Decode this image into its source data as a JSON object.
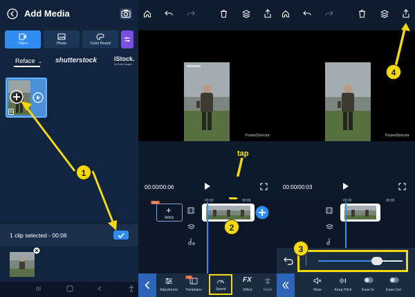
{
  "panel1": {
    "title": "Add Media",
    "tabs": [
      {
        "label": "Video",
        "active": true
      },
      {
        "label": "Photo",
        "active": false
      },
      {
        "label": "Color Board",
        "active": false
      }
    ],
    "source_filter": "Reface",
    "providers": [
      "shutterstock",
      "iStock."
    ],
    "istock_sub": "by Getty Images",
    "selection_status": "1 clip selected - 00:06",
    "callout": "1"
  },
  "panel2": {
    "watermark": "PowerDirector",
    "time": "00:00/00:06",
    "intro_badge": "New",
    "intro_label": "Intro",
    "ruler": [
      "00:00",
      "00:05"
    ],
    "tap_label": "tap",
    "callout": "2",
    "tools": [
      {
        "label": "Adjustment",
        "icon": "sliders-icon"
      },
      {
        "label": "Templates",
        "icon": "templates-icon",
        "badge": "Try"
      },
      {
        "label": "Speed",
        "icon": "speedometer-icon"
      },
      {
        "label": "Effect",
        "icon": "fx-icon"
      },
      {
        "label": "Stabil",
        "icon": "stabilizer-icon"
      }
    ],
    "fx_text": "FX"
  },
  "panel3": {
    "watermark": "PowerDirector",
    "time": "00:00/00:03",
    "ruler": [
      "00:00",
      "00:05"
    ],
    "callout_slider": "3",
    "callout_export": "4",
    "speed_fraction": 0.7,
    "tools": [
      {
        "label": "Mute",
        "icon": "mute-icon"
      },
      {
        "label": "Keep Pitch",
        "icon": "pitch-icon"
      },
      {
        "label": "Ease In",
        "icon": "ease-in-icon"
      },
      {
        "label": "Ease Out",
        "icon": "ease-out-icon"
      }
    ]
  },
  "colors": {
    "accent_blue": "#2f8cf0",
    "callout_yellow": "#f5d90f",
    "playhead": "#3d8de8"
  }
}
